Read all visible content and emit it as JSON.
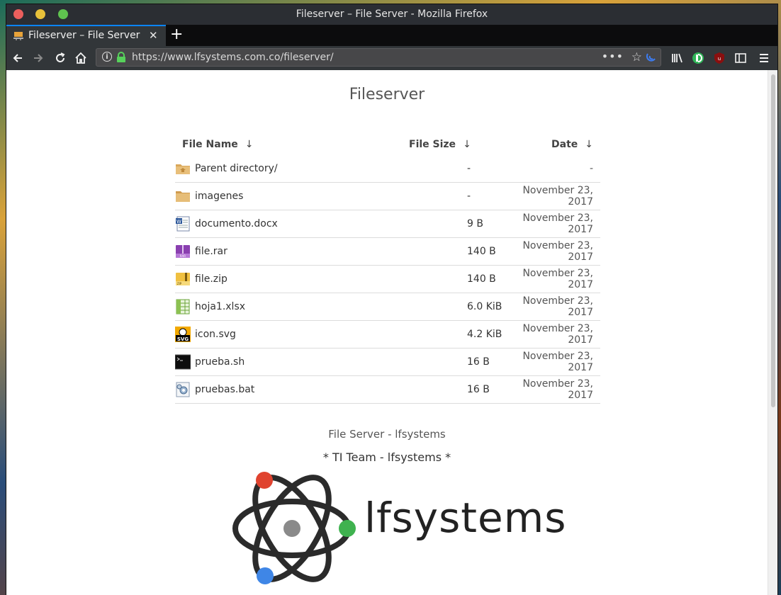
{
  "window": {
    "title": "Fileserver – File Server - Mozilla Firefox"
  },
  "tab": {
    "title": "Fileserver – File Server",
    "close": "✕",
    "new_tab": "+"
  },
  "navbar": {
    "url": "https://www.lfsystems.com.co/fileserver/"
  },
  "page": {
    "title": "Fileserver",
    "columns": {
      "name": "File Name",
      "size": "File Size",
      "date": "Date",
      "sort_arrow": "↓"
    },
    "files": [
      {
        "name": "Parent directory/",
        "size": "-",
        "date": "-",
        "icon": "parent-folder-icon"
      },
      {
        "name": "imagenes",
        "size": "-",
        "date": "November 23, 2017",
        "icon": "folder-icon"
      },
      {
        "name": "documento.docx",
        "size": "9 B",
        "date": "November 23, 2017",
        "icon": "word-doc-icon"
      },
      {
        "name": "file.rar",
        "size": "140 B",
        "date": "November 23, 2017",
        "icon": "rar-archive-icon"
      },
      {
        "name": "file.zip",
        "size": "140 B",
        "date": "November 23, 2017",
        "icon": "zip-archive-icon"
      },
      {
        "name": "hoja1.xlsx",
        "size": "6.0 KiB",
        "date": "November 23, 2017",
        "icon": "spreadsheet-icon"
      },
      {
        "name": "icon.svg",
        "size": "4.2 KiB",
        "date": "November 23, 2017",
        "icon": "svg-file-icon"
      },
      {
        "name": "prueba.sh",
        "size": "16 B",
        "date": "November 23, 2017",
        "icon": "terminal-script-icon"
      },
      {
        "name": "pruebas.bat",
        "size": "16 B",
        "date": "November 23, 2017",
        "icon": "batch-script-icon"
      }
    ],
    "footer_line1": "File Server - lfsystems",
    "footer_line2": "* TI Team - lfsystems *",
    "logo_text": "lfsystems"
  }
}
